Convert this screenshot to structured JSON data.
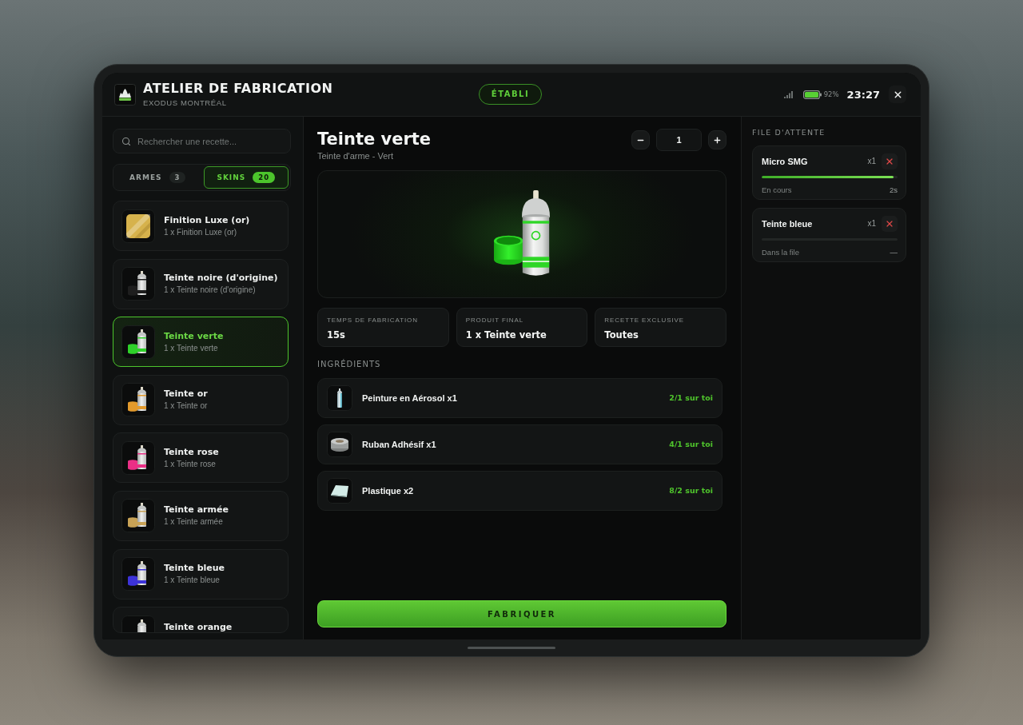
{
  "header": {
    "title": "ATELIER DE FABRICATION",
    "subtitle": "EXODUS MONTRÉAL",
    "station": "ÉTABLI",
    "battery": "92%",
    "time": "23:27"
  },
  "sidebar": {
    "search": {
      "placeholder": "Rechercher une recette..."
    },
    "tabs": [
      {
        "label": "ARMES",
        "count": "3",
        "selected": false
      },
      {
        "label": "SKINS",
        "count": "20",
        "selected": true
      }
    ],
    "recipes": [
      {
        "kind": "foil",
        "name": "Finition Luxe (or)",
        "subtitle": "1 x Finition Luxe (or)",
        "color": "#d6b24c",
        "selected": false
      },
      {
        "kind": "spray",
        "name": "Teinte noire (d'origine)",
        "subtitle": "1 x Teinte noire (d'origine)",
        "color": "#1e1e1e",
        "selected": false
      },
      {
        "kind": "spray",
        "name": "Teinte verte",
        "subtitle": "1 x Teinte verte",
        "color": "#2fd12a",
        "selected": true
      },
      {
        "kind": "spray",
        "name": "Teinte or",
        "subtitle": "1 x Teinte or",
        "color": "#e39a2c",
        "selected": false
      },
      {
        "kind": "spray",
        "name": "Teinte rose",
        "subtitle": "1 x Teinte rose",
        "color": "#ea2f86",
        "selected": false
      },
      {
        "kind": "spray",
        "name": "Teinte armée",
        "subtitle": "1 x Teinte armée",
        "color": "#c8a256",
        "selected": false
      },
      {
        "kind": "spray",
        "name": "Teinte bleue",
        "subtitle": "1 x Teinte bleue",
        "color": "#3d33d8",
        "selected": false
      },
      {
        "kind": "spray",
        "name": "Teinte orange",
        "selected": false
      }
    ]
  },
  "detail": {
    "title": "Teinte verte",
    "subtitle": "Teinte d'arme - Vert",
    "quantity": "1",
    "stats": [
      {
        "label": "TEMPS DE FABRICATION",
        "value": "15s"
      },
      {
        "label": "PRODUIT FINAL",
        "value": "1 x Teinte verte"
      },
      {
        "label": "RECETTE EXCLUSIVE",
        "value": "Toutes"
      }
    ],
    "ingredients_title": "INGRÉDIENTS",
    "ingredients": [
      {
        "kind": "aerosol",
        "name": "Peinture en Aérosol x1",
        "stock": "2/1 sur toi"
      },
      {
        "kind": "tape",
        "name": "Ruban Adhésif x1",
        "stock": "4/1 sur toi"
      },
      {
        "kind": "plastic",
        "name": "Plastique x2",
        "stock": "8/2 sur toi"
      }
    ],
    "craft_button": "FABRIQUER"
  },
  "queue": {
    "title": "FILE D'ATTENTE",
    "items": [
      {
        "name": "Micro SMG",
        "quantity": "x1",
        "level": 0.97,
        "status": "En cours",
        "time": "2s"
      },
      {
        "name": "Teinte bleue",
        "quantity": "x1",
        "status": "Dans la file",
        "time": "—"
      }
    ]
  }
}
